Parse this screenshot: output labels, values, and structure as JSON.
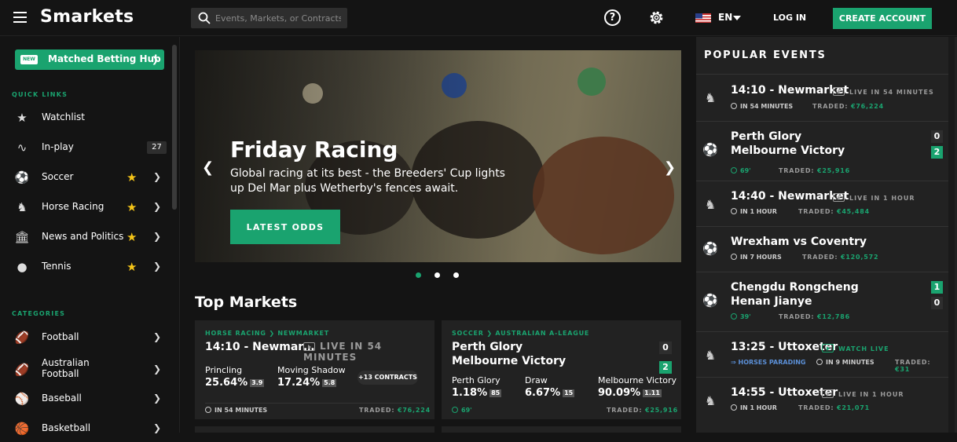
{
  "header": {
    "logo": "Smarkets",
    "search_placeholder": "Events, Markets, or Contracts",
    "help_glyph": "?",
    "language": "EN",
    "login_label": "LOG IN",
    "create_account_label": "CREATE ACCOUNT"
  },
  "sidebar": {
    "hub_badge": "NEW",
    "hub_label": "Matched Betting Hub",
    "quick_links_title": "QUICK LINKS",
    "quick_links": [
      {
        "label": "Watchlist",
        "icon": "star-icon"
      },
      {
        "label": "In-play",
        "icon": "activity-icon",
        "count": "27"
      },
      {
        "label": "Soccer",
        "icon": "soccer-icon",
        "favorite": true
      },
      {
        "label": "Horse Racing",
        "icon": "horse-icon",
        "favorite": true
      },
      {
        "label": "News and Politics",
        "icon": "government-icon",
        "favorite": true
      },
      {
        "label": "Tennis",
        "icon": "tennis-icon",
        "favorite": true
      }
    ],
    "categories_title": "CATEGORIES",
    "categories": [
      {
        "label": "Football",
        "icon": "football-icon"
      },
      {
        "label": "Australian Football",
        "line1": "Australian",
        "line2": "Football",
        "icon": "australian-football-icon"
      },
      {
        "label": "Baseball",
        "icon": "baseball-icon"
      },
      {
        "label": "Basketball",
        "icon": "basketball-icon"
      }
    ]
  },
  "hero": {
    "title": "Friday Racing",
    "subtitle": "Global racing at its best - the Breeders' Cup lights up Del Mar plus Wetherby's fences await.",
    "cta_label": "LATEST ODDS",
    "active_slide": 1,
    "slide_count": 3
  },
  "top_markets": {
    "title": "Top Markets",
    "cards": [
      {
        "breadcrumb_1": "HORSE RACING",
        "breadcrumb_2": "NEWMARKET",
        "title": "14:10 - Newmar…",
        "live_label": "LIVE IN 54 MINUTES",
        "selections": [
          {
            "name": "Princling",
            "pct": "25.64%",
            "odds": "3.9"
          },
          {
            "name": "Moving Shadow",
            "pct": "17.24%",
            "odds": "5.8"
          }
        ],
        "more_contracts": "+13 CONTRACTS",
        "time": "IN 54 MINUTES",
        "traded_label": "TRADED:",
        "traded_value": "€76,224"
      },
      {
        "breadcrumb_1": "SOCCER",
        "breadcrumb_2": "AUSTRALIAN A-LEAGUE",
        "team_home": "Perth Glory",
        "team_away": "Melbourne Victory",
        "score_home": "0",
        "score_away": "2",
        "selections": [
          {
            "name": "Perth Glory",
            "pct": "1.18%",
            "odds": "85"
          },
          {
            "name": "Draw",
            "pct": "6.67%",
            "odds": "15"
          },
          {
            "name": "Melbourne Victory",
            "pct": "90.09%",
            "odds": "1.11"
          }
        ],
        "time": "69'",
        "traded_label": "TRADED:",
        "traded_value": "€25,916"
      }
    ]
  },
  "popular_events": {
    "title": "POPULAR EVENTS",
    "items": [
      {
        "name": "14:10 - Newmarket",
        "live": "LIVE IN 54 MINUTES",
        "time": "IN 54 MINUTES",
        "traded_label": "TRADED:",
        "traded": "€76,224",
        "icon": "horse-icon"
      },
      {
        "line1": "Perth Glory",
        "line2": "Melbourne Victory",
        "time": "69'",
        "traded_label": "TRADED:",
        "traded": "€25,916",
        "score1": "0",
        "score2": "2",
        "icon": "soccer-icon"
      },
      {
        "name": "14:40 - Newmarket",
        "live": "LIVE IN 1 HOUR",
        "time": "IN 1 HOUR",
        "traded_label": "TRADED:",
        "traded": "€45,484",
        "icon": "horse-icon"
      },
      {
        "name": "Wrexham vs Coventry",
        "time": "IN 7 HOURS",
        "traded_label": "TRADED:",
        "traded": "€120,572",
        "icon": "soccer-icon"
      },
      {
        "line1": "Chengdu Rongcheng",
        "line2": "Henan Jianye",
        "time": "39'",
        "traded_label": "TRADED:",
        "traded": "€12,786",
        "score1": "1",
        "score2": "0",
        "icon": "soccer-icon"
      },
      {
        "name": "13:25 - Uttoxeter",
        "live": "WATCH LIVE",
        "status": "HORSES PARADING",
        "time": "IN 9 MINUTES",
        "traded_label": "TRADED:",
        "traded": "€31",
        "icon": "horse-icon"
      },
      {
        "name": "14:55 - Uttoxeter",
        "live": "LIVE IN 1 HOUR",
        "time": "IN 1 HOUR",
        "traded_label": "TRADED:",
        "traded": "€21,071",
        "icon": "horse-icon"
      }
    ]
  },
  "colors": {
    "accent": "#1aa36f",
    "background": "#141414",
    "panel": "#222222",
    "favorite": "#f5c518"
  }
}
